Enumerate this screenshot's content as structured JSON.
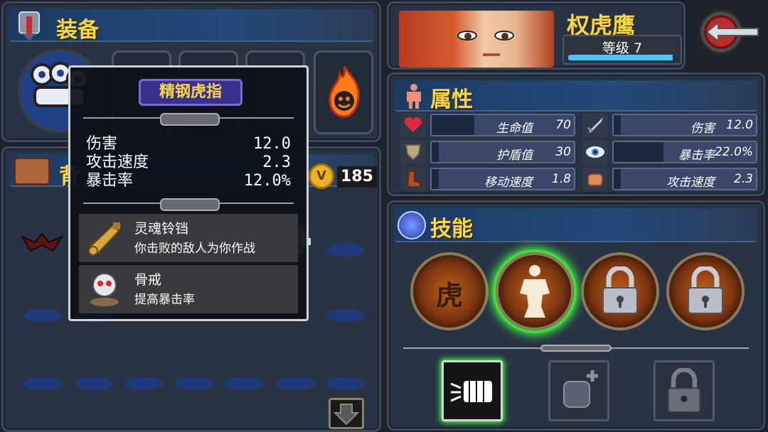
{
  "equipment": {
    "title": "装备"
  },
  "backpack": {
    "title_partial": "背",
    "gold": "185"
  },
  "character": {
    "name": "权虎鹰",
    "level_text": "等级 7",
    "level_progress": 0.97
  },
  "attributes": {
    "title": "属性",
    "stats": [
      {
        "label": "生命值",
        "value": "70",
        "icon": "heart-icon",
        "fill": 0.3
      },
      {
        "label": "伤害",
        "value": "12.0",
        "icon": "sword-icon",
        "fill": 0.05
      },
      {
        "label": "护盾值",
        "value": "30",
        "icon": "shield-icon",
        "fill": 0.05
      },
      {
        "label": "暴击率",
        "value": "22.0%",
        "icon": "eye-icon",
        "fill": 0.35
      },
      {
        "label": "移动速度",
        "value": "1.8",
        "icon": "boot-icon",
        "fill": 0.05
      },
      {
        "label": "攻击速度",
        "value": "2.3",
        "icon": "fist-icon",
        "fill": 0.05
      }
    ]
  },
  "skills": {
    "title": "技能",
    "circles": [
      {
        "name": "tiger-skill",
        "glyph": "虎",
        "state": "unlocked"
      },
      {
        "name": "fighter-skill",
        "glyph": "",
        "state": "active"
      },
      {
        "name": "locked-skill-3",
        "state": "locked"
      },
      {
        "name": "locked-skill-4",
        "state": "locked"
      }
    ],
    "squares": [
      {
        "name": "punch-skill",
        "state": "active"
      },
      {
        "name": "fist-upgrade-skill",
        "state": "available"
      },
      {
        "name": "locked-square-skill",
        "state": "locked"
      }
    ]
  },
  "tooltip": {
    "item_name": "精钢虎指",
    "stats": [
      {
        "label": "伤害",
        "value": "12.0"
      },
      {
        "label": "攻击速度",
        "value": "2.3"
      },
      {
        "label": "暴击率",
        "value": "12.0%"
      }
    ],
    "effects": [
      {
        "name": "灵魂铃铛",
        "desc": "你击败的敌人为你作战",
        "icon": "bell-icon"
      },
      {
        "name": "骨戒",
        "desc": "提高暴击率",
        "icon": "skull-ring-icon"
      }
    ]
  },
  "colors": {
    "title_gold": "#f6d64a",
    "accent_blue": "#4ac4ff",
    "active_green": "#48ff48"
  }
}
